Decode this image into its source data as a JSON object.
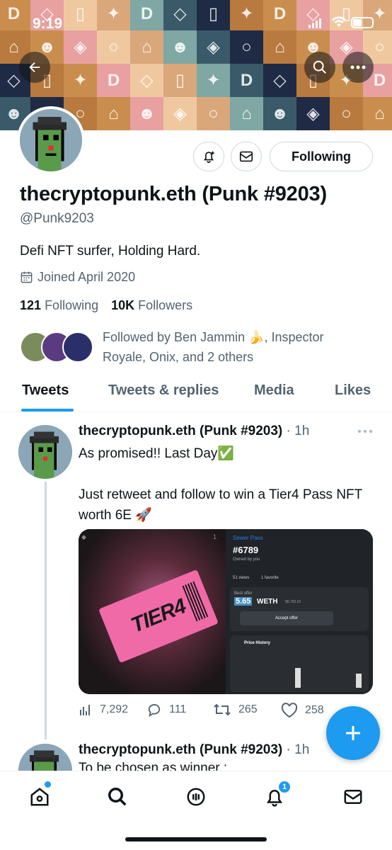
{
  "status_bar": {
    "time": "9:19"
  },
  "profile": {
    "display_name": "thecryptopunk.eth (Punk #9203)",
    "handle": "@Punk9203",
    "bio": "Defi NFT surfer, Holding Hard.",
    "joined": "Joined April 2020",
    "following_count": "121",
    "following_label": "Following",
    "followers_count": "10K",
    "followers_label": "Followers",
    "followed_by": "Followed by Ben Jammin 🍌, Inspector Royale, Onix, and 2 others",
    "follow_button_label": "Following"
  },
  "tabs": [
    {
      "label": "Tweets",
      "active": true
    },
    {
      "label": "Tweets & replies",
      "active": false
    },
    {
      "label": "Media",
      "active": false
    },
    {
      "label": "Likes",
      "active": false
    }
  ],
  "tweets": [
    {
      "author": "thecryptopunk.eth (Punk #9203)",
      "time": "· 1h",
      "text_line1": "As promised!! Last Day✅",
      "text_line2": "Just retweet and follow to win a Tier4 Pass NFT worth 6E 🚀",
      "media": {
        "collection": "Sewer Pass",
        "token": "#6789",
        "owned_by": "Owned by you",
        "views": "51 views",
        "favorites": "1 favorite",
        "best_offer_label": "Best offer",
        "offer_amount": "5.65",
        "offer_currency": "WETH",
        "offer_usd": "$8,782.92",
        "accept_label": "Accept offer",
        "price_history_label": "Price History",
        "ticket_text": "TIER4",
        "likes_small": "1"
      },
      "views": "7,292",
      "replies": "111",
      "retweets": "265",
      "likes": "258"
    },
    {
      "author": "thecryptopunk.eth (Punk #9203)",
      "time": "· 1h",
      "text_preview": "To be chosen as winner :"
    }
  ],
  "nav": {
    "notifications_badge": "1"
  },
  "colors": {
    "accent": "#1d9bf0",
    "text": "#0f1419",
    "muted": "#536471"
  }
}
